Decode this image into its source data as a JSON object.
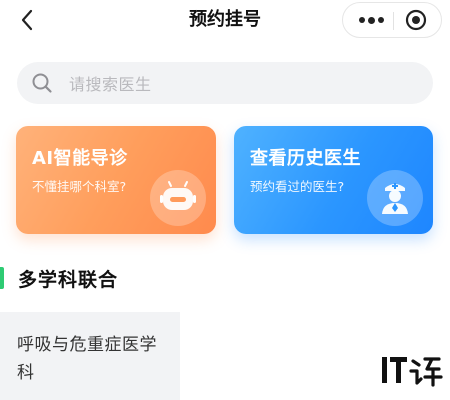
{
  "header": {
    "title": "预约挂号",
    "back_icon": "chevron-left-icon",
    "more_icon": "more-dots-icon",
    "close_icon": "target-close-icon"
  },
  "search": {
    "placeholder": "请搜索医生",
    "icon": "search-icon"
  },
  "cards": [
    {
      "title": "AI智能导诊",
      "subtitle": "不懂挂哪个科室?",
      "icon": "robot-icon",
      "color_from": "#ffb27a",
      "color_to": "#ff8a4d"
    },
    {
      "title": "查看历史医生",
      "subtitle": "预约看过的医生?",
      "icon": "doctor-icon",
      "color_from": "#4fb2ff",
      "color_to": "#1e86ff"
    }
  ],
  "section": {
    "title": "多学科联合",
    "accent_color": "#2ecb73"
  },
  "departments": [
    {
      "label": "呼吸与危重症医学科"
    }
  ],
  "watermark": {
    "text": "IT之家"
  }
}
